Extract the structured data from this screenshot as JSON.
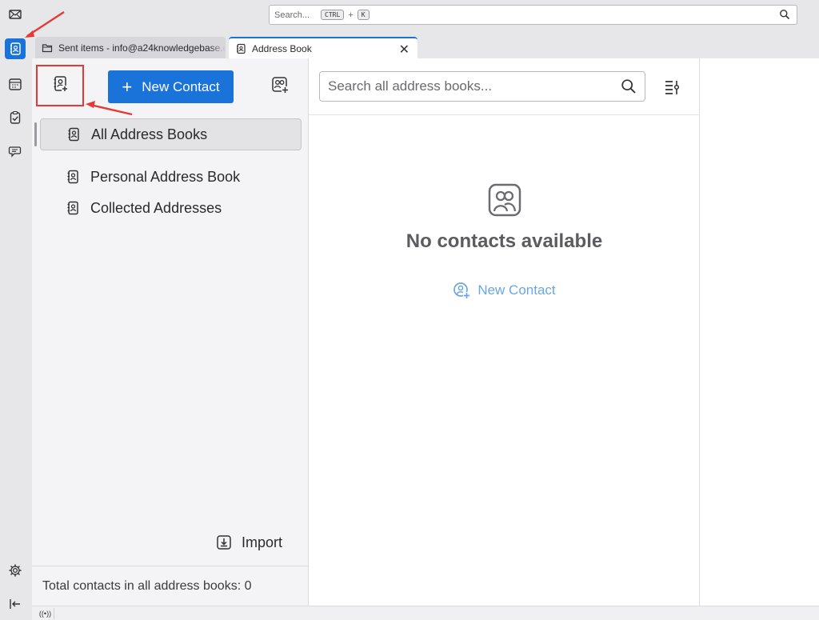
{
  "spaces": {
    "items": [
      {
        "name": "mail",
        "icon": "envelope-icon"
      },
      {
        "name": "address-book",
        "icon": "address-book-icon",
        "active": true
      },
      {
        "name": "calendar",
        "icon": "calendar-icon"
      },
      {
        "name": "tasks",
        "icon": "tasks-icon"
      },
      {
        "name": "chat",
        "icon": "chat-icon"
      }
    ],
    "settings_icon": "gear-icon",
    "collapse_icon": "collapse-arrow-icon"
  },
  "global_search": {
    "placeholder": "Search...",
    "shortcut_key1": "CTRL",
    "shortcut_plus": "+",
    "shortcut_key2": "K"
  },
  "tabs": [
    {
      "label": "Sent items - info@a24knowledgebase.c",
      "icon": "folder-icon",
      "active": false
    },
    {
      "label": "Address Book",
      "icon": "address-book-icon",
      "active": true,
      "close": "✕"
    }
  ],
  "sidebar": {
    "new_contact_label": "New Contact",
    "new_contact_plus": "+",
    "address_books": [
      {
        "label": "All Address Books",
        "selected": true
      },
      {
        "label": "Personal Address Book",
        "selected": false
      },
      {
        "label": "Collected Addresses",
        "selected": false
      }
    ],
    "import_label": "Import",
    "footer_text": "Total contacts in all address books: 0"
  },
  "list_pane": {
    "search_placeholder": "Search all address books...",
    "empty_title": "No contacts available",
    "empty_new_contact_label": "New Contact"
  },
  "statusbar": {
    "online_icon": "online-status-icon"
  },
  "colors": {
    "accent": "#1a73d8",
    "annotation": "#e53935",
    "link_muted": "#6aa6e0"
  }
}
